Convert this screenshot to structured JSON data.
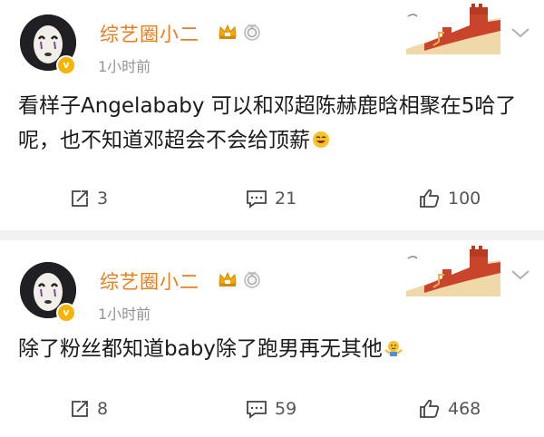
{
  "posts": [
    {
      "username": "综艺圈小二",
      "time": "1小时前",
      "text": "看样子Angelababy 可以和邓超陈赫鹿晗相聚在5哈了呢，也不知道邓超会不会给顶薪",
      "emoji": "laughing-emoji",
      "reposts": "3",
      "comments": "21",
      "likes": "100"
    },
    {
      "username": "综艺圈小二",
      "time": "1小时前",
      "text": "除了粉丝都知道baby除了跑男再无其他",
      "emoji": "shrug-emoji",
      "reposts": "8",
      "comments": "59",
      "likes": "468"
    }
  ],
  "colors": {
    "username": "#e67e22",
    "verified": "#f5b400",
    "meta": "#939393",
    "separator": "#f2f2f2"
  },
  "icons": [
    "verified-badge-icon",
    "vip-crown-icon",
    "medal-icon",
    "great-wall-decoration",
    "chevron-down-icon",
    "repost-icon",
    "comment-icon",
    "like-icon"
  ]
}
